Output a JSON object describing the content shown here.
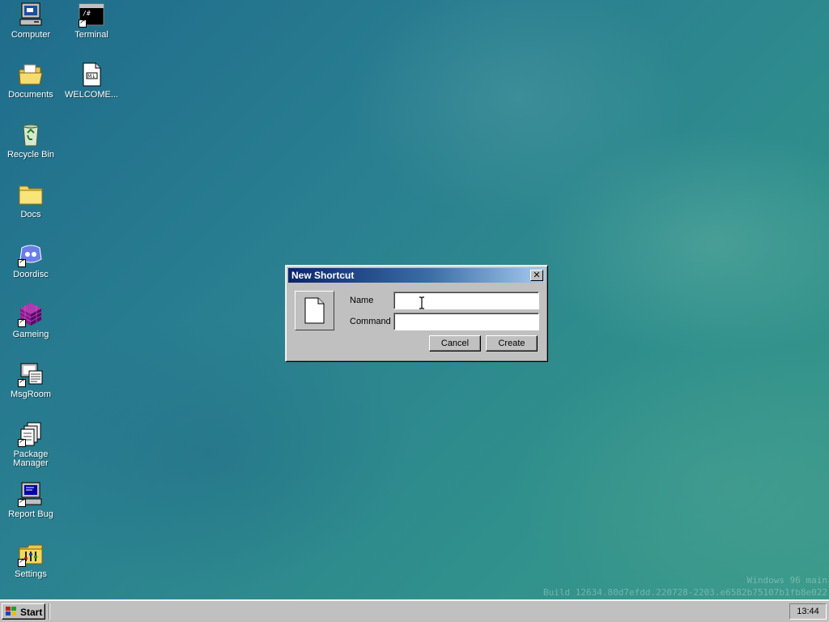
{
  "desktop": {
    "icons": [
      {
        "label": "Computer",
        "icon": "computer-icon"
      },
      {
        "label": "Terminal",
        "icon": "terminal-icon",
        "cmd": "/#"
      },
      {
        "label": "Documents",
        "icon": "documents-folder-icon"
      },
      {
        "label": "WELCOME...",
        "icon": "markdown-file-icon",
        "badge": "M↓"
      },
      {
        "label": "Recycle Bin",
        "icon": "recycle-bin-icon"
      },
      {
        "label": "Docs",
        "icon": "folder-icon"
      },
      {
        "label": "Doordisc",
        "icon": "doordisc-icon"
      },
      {
        "label": "Gameing",
        "icon": "game-cube-icon"
      },
      {
        "label": "MsgRoom",
        "icon": "msgroom-icon"
      },
      {
        "label": "Package\nManager",
        "icon": "package-manager-icon"
      },
      {
        "label": "Report Bug",
        "icon": "report-bug-icon"
      },
      {
        "label": "Settings",
        "icon": "settings-icon"
      }
    ]
  },
  "dialog": {
    "title": "New Shortcut",
    "close_glyph": "✕",
    "name_label": "Name",
    "name_value": "",
    "command_label": "Command",
    "command_value": "",
    "cancel_label": "Cancel",
    "create_label": "Create"
  },
  "watermark": {
    "line1": "Windows 96 main",
    "line2": "Build 12634.80d7efdd.220728-2203.e6582b75107b1fb8e022"
  },
  "taskbar": {
    "start_label": "Start",
    "clock": "13:44"
  },
  "colors": {
    "desktop": "#2a8090",
    "titlebar_start": "#0a246a",
    "titlebar_end": "#a6caf0",
    "chrome": "#c0c0c0"
  }
}
